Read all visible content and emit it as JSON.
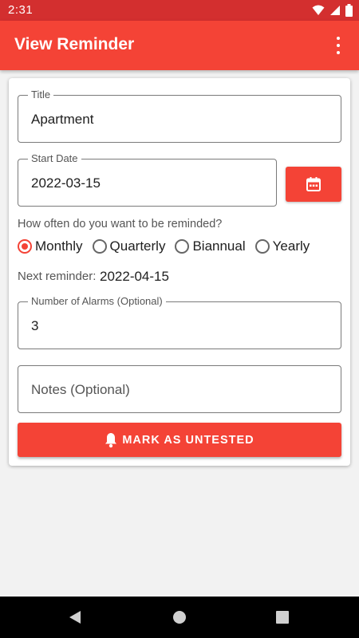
{
  "status_bar": {
    "time": "2:31"
  },
  "app_bar": {
    "title": "View Reminder",
    "menu_icon": "more-vert-icon"
  },
  "form": {
    "title": {
      "label": "Title",
      "value": "Apartment"
    },
    "start_date": {
      "label": "Start Date",
      "value": "2022-03-15",
      "calendar_icon": "calendar-icon"
    },
    "frequency": {
      "question": "How often do you want to be reminded?",
      "options": [
        "Monthly",
        "Quarterly",
        "Biannual",
        "Yearly"
      ],
      "selected": "Monthly"
    },
    "next_reminder": {
      "label": "Next reminder:",
      "value": "2022-04-15"
    },
    "alarms": {
      "label": "Number of Alarms (Optional)",
      "value": "3"
    },
    "notes": {
      "placeholder": "Notes (Optional)"
    },
    "mark_button": {
      "label": "MARK AS UNTESTED",
      "icon": "bell-icon"
    }
  },
  "colors": {
    "primary": "#f44336",
    "primary_dark": "#d32f2f",
    "background": "#f2f2f2"
  }
}
